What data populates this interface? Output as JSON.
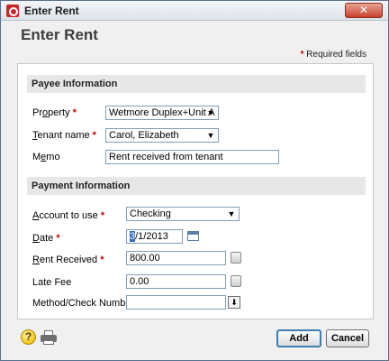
{
  "window": {
    "title": "Enter Rent",
    "close_glyph": "✕"
  },
  "page": {
    "heading": "Enter Rent",
    "required_star": "*",
    "required_note": "Required fields"
  },
  "payee": {
    "header": "Payee Information",
    "property": {
      "label_pre": "Pr",
      "label_key": "o",
      "label_post": "perty",
      "value": "Wetmore Duplex+Unit A"
    },
    "tenant": {
      "label_key": "T",
      "label_post": "enant name",
      "value": "Carol, Elizabeth"
    },
    "memo": {
      "label_pre": "M",
      "label_key": "e",
      "label_post": "mo",
      "value": "Rent received from tenant"
    }
  },
  "payment": {
    "header": "Payment Information",
    "account": {
      "label_pre": "",
      "label_key": "A",
      "label_post": "ccount to use",
      "value": "Checking"
    },
    "date": {
      "label_pre": "",
      "label_key": "D",
      "label_post": "ate",
      "value_sel": "3",
      "value_rest": "/1/2013"
    },
    "rent": {
      "label_pre": "",
      "label_key": "R",
      "label_post": "ent Received",
      "value": "800.00"
    },
    "late_fee": {
      "label": "Late Fee",
      "value": "0.00"
    },
    "method": {
      "label": "Method/Check Number",
      "value": ""
    }
  },
  "buttons": {
    "add": "Add",
    "cancel": "Cancel"
  },
  "icons": {
    "help": "?",
    "dropdown": "▼",
    "method_picker": "⬇"
  }
}
